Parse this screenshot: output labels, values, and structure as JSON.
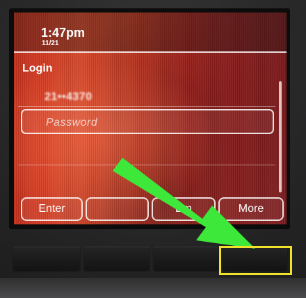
{
  "status": {
    "time": "1:47pm",
    "date": "11/21"
  },
  "login": {
    "title": "Login",
    "user_id": "21••4370",
    "password_placeholder": "Password"
  },
  "softkeys": [
    {
      "label": "Enter"
    },
    {
      "label": ""
    },
    {
      "label": "Em"
    },
    {
      "label": "More"
    }
  ],
  "annotation": {
    "arrow_color": "#3ee83a",
    "highlight_color": "#f0e22a"
  },
  "colors": {
    "screen_base": "#c9301c",
    "bezel": "#0c0c0c"
  }
}
